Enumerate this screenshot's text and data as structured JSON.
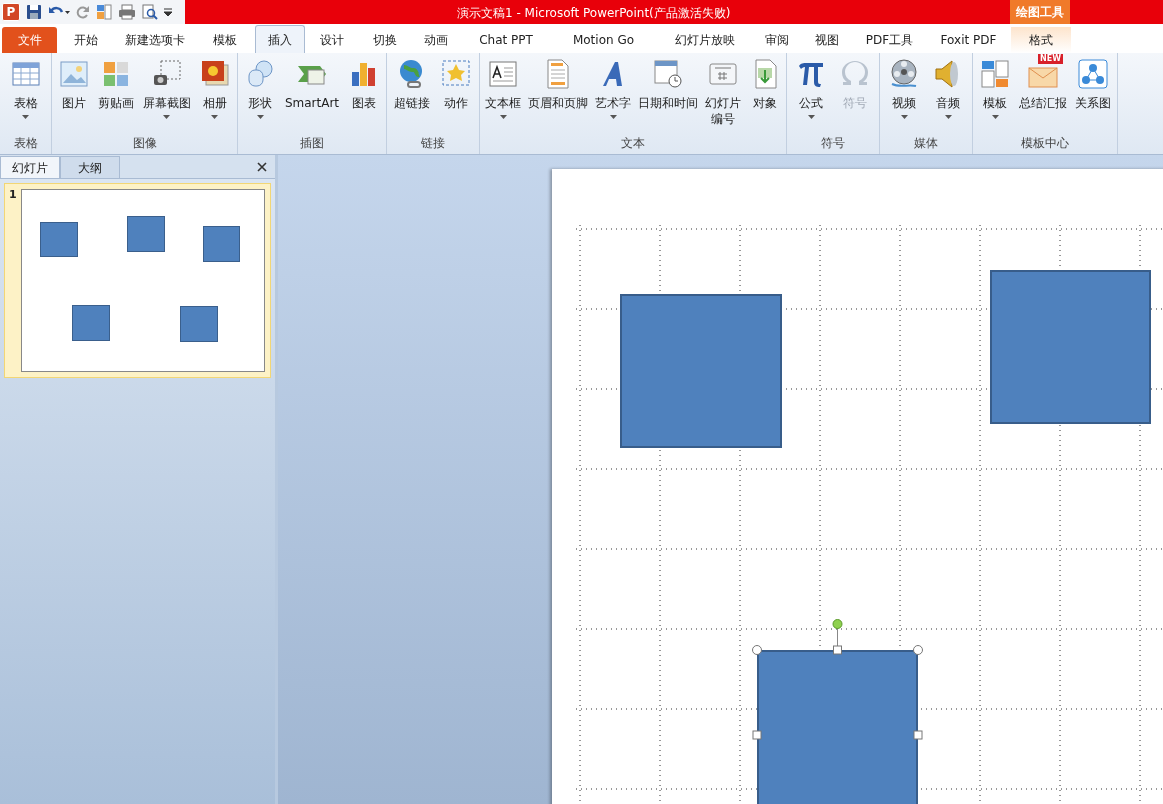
{
  "title_bar": {
    "logo": "P",
    "title": "演示文稿1 - Microsoft PowerPoint(产品激活失败)",
    "context_header": "绘图工具"
  },
  "tabs": [
    {
      "label": "文件",
      "kind": "file",
      "selected": false
    },
    {
      "label": "开始",
      "kind": "normal",
      "selected": false
    },
    {
      "label": "新建选项卡",
      "kind": "normal",
      "selected": false
    },
    {
      "label": "模板",
      "kind": "normal",
      "selected": false
    },
    {
      "label": "插入",
      "kind": "normal",
      "selected": true
    },
    {
      "label": "设计",
      "kind": "normal",
      "selected": false
    },
    {
      "label": "切换",
      "kind": "normal",
      "selected": false
    },
    {
      "label": "动画",
      "kind": "normal",
      "selected": false
    },
    {
      "label": "Chat PPT",
      "kind": "normal",
      "selected": false
    },
    {
      "label": "Motion Go",
      "kind": "normal",
      "selected": false
    },
    {
      "label": "幻灯片放映",
      "kind": "normal",
      "selected": false
    },
    {
      "label": "审阅",
      "kind": "normal",
      "selected": false
    },
    {
      "label": "视图",
      "kind": "normal",
      "selected": false
    },
    {
      "label": "PDF工具",
      "kind": "normal",
      "selected": false
    },
    {
      "label": "Foxit PDF",
      "kind": "normal",
      "selected": false
    },
    {
      "label": "格式",
      "kind": "context",
      "selected": false
    }
  ],
  "ribbon_groups": [
    {
      "label": "表格",
      "buttons": [
        {
          "label": "表格",
          "dropdown": true,
          "disabled": false
        }
      ]
    },
    {
      "label": "图像",
      "buttons": [
        {
          "label": "图片",
          "dropdown": false,
          "disabled": false
        },
        {
          "label": "剪贴画",
          "dropdown": false,
          "disabled": false
        },
        {
          "label": "屏幕截图",
          "dropdown": true,
          "disabled": false
        },
        {
          "label": "相册",
          "dropdown": true,
          "disabled": false
        }
      ]
    },
    {
      "label": "插图",
      "buttons": [
        {
          "label": "形状",
          "dropdown": true,
          "disabled": false
        },
        {
          "label": "SmartArt",
          "dropdown": false,
          "disabled": false
        },
        {
          "label": "图表",
          "dropdown": false,
          "disabled": false
        }
      ]
    },
    {
      "label": "链接",
      "buttons": [
        {
          "label": "超链接",
          "dropdown": false,
          "disabled": false
        },
        {
          "label": "动作",
          "dropdown": false,
          "disabled": false
        }
      ]
    },
    {
      "label": "文本",
      "buttons": [
        {
          "label": "文本框",
          "dropdown": true,
          "disabled": false
        },
        {
          "label": "页眉和页脚",
          "dropdown": false,
          "disabled": false
        },
        {
          "label": "艺术字",
          "dropdown": true,
          "disabled": false
        },
        {
          "label": "日期和时间",
          "dropdown": false,
          "disabled": false
        },
        {
          "label": "幻灯片编号",
          "dropdown": false,
          "disabled": false
        },
        {
          "label": "对象",
          "dropdown": false,
          "disabled": false
        }
      ]
    },
    {
      "label": "符号",
      "buttons": [
        {
          "label": "公式",
          "dropdown": true,
          "disabled": false
        },
        {
          "label": "符号",
          "dropdown": false,
          "disabled": true
        }
      ]
    },
    {
      "label": "媒体",
      "buttons": [
        {
          "label": "视频",
          "dropdown": true,
          "disabled": false
        },
        {
          "label": "音频",
          "dropdown": true,
          "disabled": false
        }
      ]
    },
    {
      "label": "模板中心",
      "buttons": [
        {
          "label": "模板",
          "dropdown": true,
          "disabled": false
        },
        {
          "label": "总结汇报",
          "dropdown": false,
          "disabled": false,
          "badge": "NEW"
        },
        {
          "label": "关系图",
          "dropdown": false,
          "disabled": false
        }
      ]
    }
  ],
  "slides_panel": {
    "tabs": [
      {
        "label": "幻灯片",
        "selected": true
      },
      {
        "label": "大纲",
        "selected": false
      }
    ],
    "slides": [
      {
        "number": "1",
        "selected": true
      }
    ]
  },
  "slide_shapes": [
    {
      "selected": false
    },
    {
      "selected": false
    },
    {
      "selected": true
    }
  ]
}
